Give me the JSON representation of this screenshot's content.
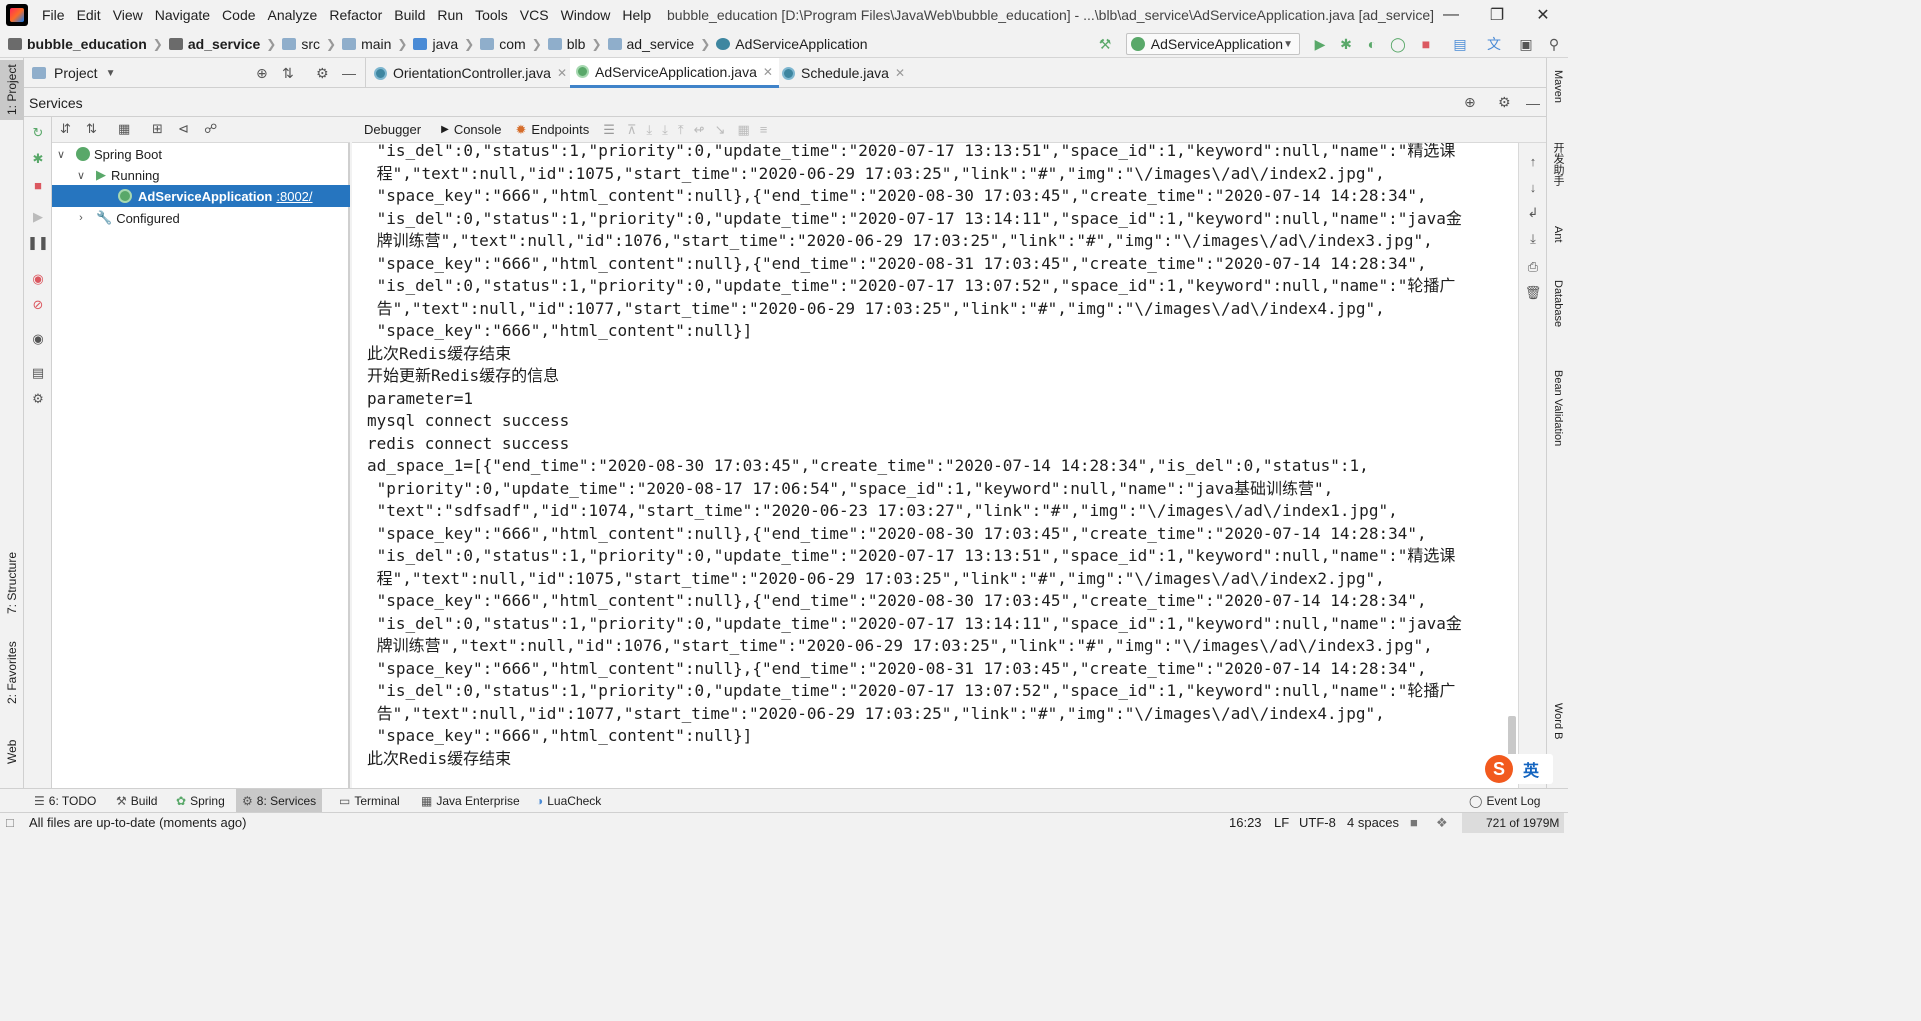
{
  "menubar": {
    "items": [
      "File",
      "Edit",
      "View",
      "Navigate",
      "Code",
      "Analyze",
      "Refactor",
      "Build",
      "Run",
      "Tools",
      "VCS",
      "Window",
      "Help"
    ],
    "window_title": "bubble_education [D:\\Program Files\\JavaWeb\\bubble_education] - ...\\blb\\ad_service\\AdServiceApplication.java [ad_service]"
  },
  "breadcrumb": [
    "bubble_education",
    "ad_service",
    "src",
    "main",
    "java",
    "com",
    "blb",
    "ad_service",
    "AdServiceApplication"
  ],
  "run_config": {
    "label": "AdServiceApplication"
  },
  "project_panel": {
    "label": "Project"
  },
  "editor_tabs": [
    {
      "label": "OrientationController.java",
      "active": false
    },
    {
      "label": "AdServiceApplication.java",
      "active": true
    },
    {
      "label": "Schedule.java",
      "active": false
    }
  ],
  "services": {
    "title": "Services",
    "tree": {
      "root": "Spring Boot",
      "running": "Running",
      "app": "AdServiceApplication",
      "port": ":8002/",
      "configured": "Configured"
    },
    "console_tabs": [
      "Debugger",
      "Console",
      "Endpoints"
    ]
  },
  "left_strip": {
    "project": "1: Project",
    "structure": "7: Structure",
    "favorites": "2: Favorites",
    "web": "Web"
  },
  "right_strip": {
    "maven": "Maven",
    "helper": "开发助手",
    "ant": "Ant",
    "database": "Database",
    "bean": "Bean Validation",
    "word": "Word B"
  },
  "console_lines": [
    " \"is_del\":0,\"status\":1,\"priority\":0,\"update_time\":\"2020-07-17 13:13:51\",\"space_id\":1,\"keyword\":null,\"name\":\"精选课",
    " 程\",\"text\":null,\"id\":1075,\"start_time\":\"2020-06-29 17:03:25\",\"link\":\"#\",\"img\":\"\\/images\\/ad\\/index2.jpg\",",
    " \"space_key\":\"666\",\"html_content\":null},{\"end_time\":\"2020-08-30 17:03:45\",\"create_time\":\"2020-07-14 14:28:34\",",
    " \"is_del\":0,\"status\":1,\"priority\":0,\"update_time\":\"2020-07-17 13:14:11\",\"space_id\":1,\"keyword\":null,\"name\":\"java金",
    " 牌训练营\",\"text\":null,\"id\":1076,\"start_time\":\"2020-06-29 17:03:25\",\"link\":\"#\",\"img\":\"\\/images\\/ad\\/index3.jpg\",",
    " \"space_key\":\"666\",\"html_content\":null},{\"end_time\":\"2020-08-31 17:03:45\",\"create_time\":\"2020-07-14 14:28:34\",",
    " \"is_del\":0,\"status\":1,\"priority\":0,\"update_time\":\"2020-07-17 13:07:52\",\"space_id\":1,\"keyword\":null,\"name\":\"轮播广",
    " 告\",\"text\":null,\"id\":1077,\"start_time\":\"2020-06-29 17:03:25\",\"link\":\"#\",\"img\":\"\\/images\\/ad\\/index4.jpg\",",
    " \"space_key\":\"666\",\"html_content\":null}]",
    "此次Redis缓存结束",
    "开始更新Redis缓存的信息",
    "parameter=1",
    "mysql connect success",
    "redis connect success",
    "ad_space_1=[{\"end_time\":\"2020-08-30 17:03:45\",\"create_time\":\"2020-07-14 14:28:34\",\"is_del\":0,\"status\":1,",
    " \"priority\":0,\"update_time\":\"2020-08-17 17:06:54\",\"space_id\":1,\"keyword\":null,\"name\":\"java基础训练营\",",
    " \"text\":\"sdfsadf\",\"id\":1074,\"start_time\":\"2020-06-23 17:03:27\",\"link\":\"#\",\"img\":\"\\/images\\/ad\\/index1.jpg\",",
    " \"space_key\":\"666\",\"html_content\":null},{\"end_time\":\"2020-08-30 17:03:45\",\"create_time\":\"2020-07-14 14:28:34\",",
    " \"is_del\":0,\"status\":1,\"priority\":0,\"update_time\":\"2020-07-17 13:13:51\",\"space_id\":1,\"keyword\":null,\"name\":\"精选课",
    " 程\",\"text\":null,\"id\":1075,\"start_time\":\"2020-06-29 17:03:25\",\"link\":\"#\",\"img\":\"\\/images\\/ad\\/index2.jpg\",",
    " \"space_key\":\"666\",\"html_content\":null},{\"end_time\":\"2020-08-30 17:03:45\",\"create_time\":\"2020-07-14 14:28:34\",",
    " \"is_del\":0,\"status\":1,\"priority\":0,\"update_time\":\"2020-07-17 13:14:11\",\"space_id\":1,\"keyword\":null,\"name\":\"java金",
    " 牌训练营\",\"text\":null,\"id\":1076,\"start_time\":\"2020-06-29 17:03:25\",\"link\":\"#\",\"img\":\"\\/images\\/ad\\/index3.jpg\",",
    " \"space_key\":\"666\",\"html_content\":null},{\"end_time\":\"2020-08-31 17:03:45\",\"create_time\":\"2020-07-14 14:28:34\",",
    " \"is_del\":0,\"status\":1,\"priority\":0,\"update_time\":\"2020-07-17 13:07:52\",\"space_id\":1,\"keyword\":null,\"name\":\"轮播广",
    " 告\",\"text\":null,\"id\":1077,\"start_time\":\"2020-06-29 17:03:25\",\"link\":\"#\",\"img\":\"\\/images\\/ad\\/index4.jpg\",",
    " \"space_key\":\"666\",\"html_content\":null}]",
    "此次Redis缓存结束"
  ],
  "bottom_tabs": [
    {
      "label": "6: TODO",
      "active": false
    },
    {
      "label": "Build",
      "active": false
    },
    {
      "label": "Spring",
      "active": false
    },
    {
      "label": "8: Services",
      "active": true
    },
    {
      "label": "Terminal",
      "active": false
    },
    {
      "label": "Java Enterprise",
      "active": false
    },
    {
      "label": "LuaCheck",
      "active": false
    },
    {
      "label": "Event Log",
      "active": false
    }
  ],
  "status": {
    "message": "All files are up-to-date (moments ago)",
    "position": "16:23",
    "line_sep": "LF",
    "encoding": "UTF-8",
    "indent": "4 spaces",
    "memory": "721 of 1979M"
  },
  "ime": {
    "label": "英"
  },
  "colors": {
    "accent": "#2675bf",
    "run_green": "#59a869",
    "stop_red": "#db5860"
  }
}
